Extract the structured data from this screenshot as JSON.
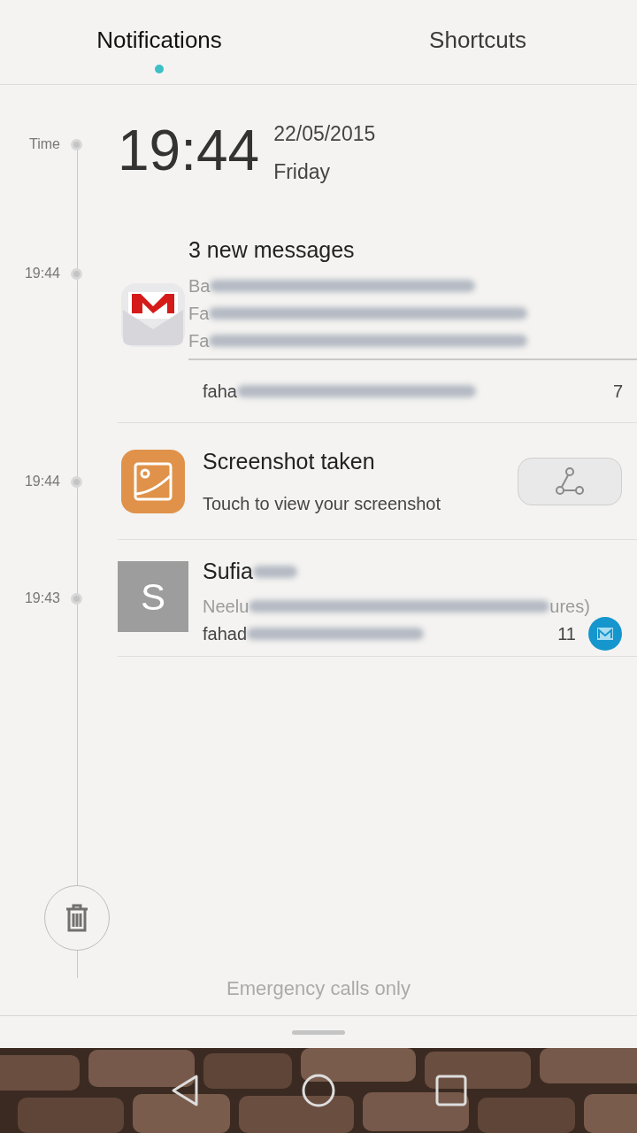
{
  "tabs": [
    {
      "label": "Notifications",
      "selected": true
    },
    {
      "label": "Shortcuts",
      "selected": false
    }
  ],
  "header": {
    "time_label": "Time",
    "clock": "19:44",
    "date": "22/05/2015",
    "weekday": "Friday"
  },
  "notifications": [
    {
      "kind": "gmail",
      "time": "19:44",
      "title": "3 new messages",
      "lines": [
        "Ba",
        "Fa",
        "Fa"
      ],
      "account": "faha",
      "count": "7"
    },
    {
      "kind": "screenshot",
      "time": "19:44",
      "title": "Screenshot taken",
      "text": "Touch to view your screenshot"
    },
    {
      "kind": "contact",
      "time": "19:43",
      "avatar": "S",
      "title": "Sufia",
      "preview_start": "Neelu",
      "preview_end": "ures)",
      "account": "fahad",
      "count": "11"
    }
  ],
  "footer": {
    "status": "Emergency calls only"
  }
}
